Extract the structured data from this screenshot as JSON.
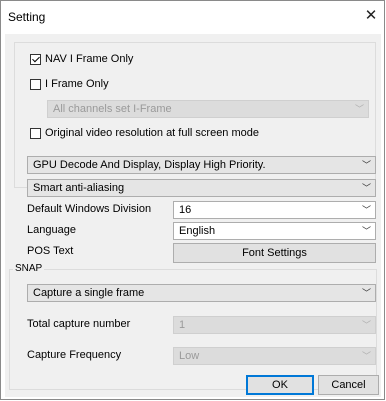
{
  "window": {
    "title": "Setting"
  },
  "options": {
    "nav_iframe_only": {
      "label": "NAV I Frame Only",
      "checked": true
    },
    "iframe_only": {
      "label": "I Frame Only",
      "checked": false
    },
    "iframe_channels": {
      "value": "All channels set I-Frame",
      "enabled": false
    },
    "original_resolution": {
      "label": "Original video resolution at full screen mode",
      "checked": false
    }
  },
  "display": {
    "gpu_mode": "GPU Decode And Display, Display High Priority.",
    "anti_aliasing": "Smart anti-aliasing",
    "default_windows_division": {
      "label": "Default Windows Division",
      "value": "16"
    },
    "language": {
      "label": "Language",
      "value": "English"
    },
    "pos_text": {
      "label": "POS Text",
      "button": "Font Settings"
    }
  },
  "snap": {
    "group_label": "SNAP",
    "mode": "Capture a single frame",
    "total_capture_number": {
      "label": "Total capture number",
      "value": "1",
      "enabled": false
    },
    "capture_frequency": {
      "label": "Capture Frequency",
      "value": "Low",
      "enabled": false
    }
  },
  "buttons": {
    "ok": "OK",
    "cancel": "Cancel"
  },
  "colors": {
    "client_bg": "#f0f0f0",
    "default_button_border": "#0078d7"
  }
}
